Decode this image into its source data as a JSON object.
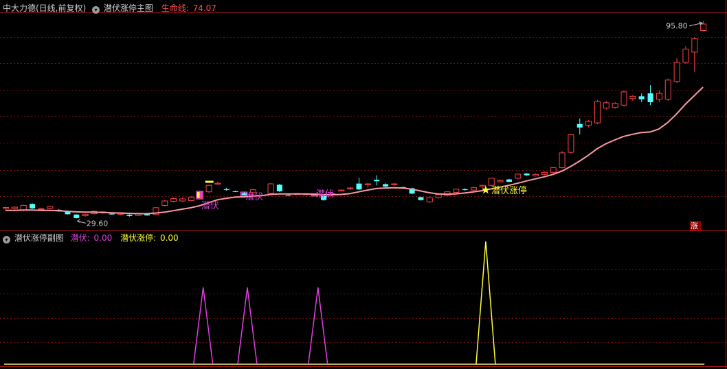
{
  "main_header": {
    "title": "中大力德(日线,前复权)",
    "indicator": "潜伏涨停主图",
    "line_label": "生命线:",
    "line_value": "74.07"
  },
  "sub_header": {
    "title": "潜伏涨停副图",
    "s1_label": "潜伏:",
    "s1_value": "0.00",
    "s2_label": "潜伏涨停:",
    "s2_value": "0.00"
  },
  "colors": {
    "up": "#ff4444",
    "down": "#54ffff",
    "ma": "#ff9aa6",
    "grid": "#7a1010",
    "qianfu": "#e040e0",
    "zhangting": "#ffff33"
  },
  "chart_data": [
    {
      "type": "candlestick",
      "name": "潜伏涨停主图",
      "price_range": [
        25.5,
        99.0
      ],
      "annotations": {
        "high": "95.80",
        "low": "29.60",
        "signal_label": "潜伏涨停",
        "qianfu_labels": [
          "潜伏",
          "潜伏",
          "潜伏"
        ],
        "zhang_badge": "涨"
      },
      "candles": [
        [
          33.0,
          33.3,
          32.8,
          32.6,
          33.6
        ],
        [
          32.9,
          33.4,
          32.7,
          32.6,
          33.6
        ],
        [
          32.4,
          34.0,
          32.2,
          32.0,
          34.2
        ],
        [
          34.5,
          33.0,
          33.1,
          32.8,
          34.7
        ],
        [
          32.8,
          32.9,
          32.7,
          32.5,
          33.2
        ],
        [
          33.0,
          33.6,
          32.8,
          32.7,
          33.8
        ],
        [
          32.5,
          32.0,
          32.5,
          31.9,
          32.7
        ],
        [
          32.0,
          31.0,
          31.9,
          30.9,
          32.2
        ],
        [
          30.9,
          29.7,
          30.9,
          29.6,
          31.0
        ],
        [
          30.5,
          31.0,
          30.4,
          30.2,
          31.2
        ],
        [
          31.2,
          32.0,
          31.1,
          30.9,
          32.2
        ],
        [
          31.5,
          31.8,
          31.3,
          31.2,
          32.0
        ],
        [
          31.2,
          31.0,
          31.1,
          30.9,
          31.4
        ],
        [
          31.0,
          31.5,
          30.8,
          30.7,
          31.6
        ],
        [
          30.8,
          30.4,
          30.7,
          30.2,
          31.0
        ],
        [
          30.6,
          31.2,
          30.5,
          30.4,
          31.4
        ],
        [
          31.0,
          30.6,
          30.9,
          30.5,
          31.1
        ],
        [
          30.9,
          33.2,
          30.8,
          30.7,
          33.4
        ],
        [
          34.0,
          35.5,
          33.8,
          33.6,
          35.8
        ],
        [
          35.4,
          36.3,
          35.2,
          35.1,
          36.6
        ],
        [
          35.5,
          36.2,
          35.4,
          35.2,
          36.5
        ],
        [
          35.6,
          36.8,
          35.5,
          35.4,
          37.2
        ],
        [
          36.5,
          38.5,
          36.3,
          36.2,
          38.8
        ],
        [
          38.6,
          40.8,
          38.5,
          38.3,
          41.0
        ],
        [
          41.4,
          41.5,
          41.2,
          41.0,
          42.0
        ],
        [
          39.5,
          39.3,
          39.4,
          39.0,
          40.0
        ],
        [
          38.8,
          38.6,
          38.7,
          38.5,
          39.0
        ],
        [
          38.2,
          37.5,
          38.1,
          37.4,
          38.5
        ],
        [
          38.3,
          39.3,
          38.3,
          38.0,
          39.6
        ],
        [
          37.5,
          37.4,
          37.5,
          37.2,
          37.8
        ],
        [
          38.1,
          41.3,
          38.0,
          37.8,
          41.6
        ],
        [
          41.0,
          38.8,
          41.0,
          38.5,
          41.3
        ],
        [
          37.6,
          37.5,
          37.6,
          37.4,
          37.8
        ],
        [
          37.9,
          38.0,
          37.8,
          37.7,
          38.2
        ],
        [
          37.8,
          37.9,
          37.7,
          37.6,
          38.0
        ],
        [
          37.5,
          37.6,
          37.4,
          37.3,
          37.8
        ],
        [
          37.2,
          35.8,
          37.1,
          35.6,
          37.3
        ],
        [
          38.0,
          37.8,
          37.8,
          37.6,
          38.0
        ],
        [
          39.1,
          39.2,
          39.0,
          38.9,
          39.3
        ],
        [
          39.8,
          39.9,
          39.6,
          39.2,
          40.2
        ],
        [
          41.4,
          39.4,
          41.3,
          39.2,
          43.4
        ],
        [
          41.2,
          41.3,
          41.0,
          40.0,
          41.6
        ],
        [
          42.7,
          42.2,
          42.5,
          40.8,
          44.2
        ],
        [
          41.2,
          40.4,
          41.0,
          40.2,
          41.5
        ],
        [
          41.0,
          41.3,
          40.8,
          40.6,
          41.6
        ],
        [
          40.2,
          39.8,
          40.1,
          39.6,
          40.4
        ],
        [
          39.8,
          38.0,
          39.8,
          37.8,
          40.0
        ],
        [
          36.8,
          35.8,
          36.8,
          35.6,
          37.0
        ],
        [
          35.2,
          36.6,
          35.0,
          34.8,
          36.8
        ],
        [
          36.6,
          37.7,
          36.4,
          36.3,
          37.9
        ],
        [
          37.4,
          38.6,
          37.3,
          37.2,
          38.8
        ],
        [
          38.4,
          39.5,
          38.3,
          38.2,
          39.7
        ],
        [
          39.5,
          39.2,
          39.3,
          39.0,
          39.8
        ],
        [
          39.2,
          40.0,
          39.1,
          39.0,
          40.3
        ],
        [
          40.3,
          40.8,
          40.2,
          40.0,
          41.0
        ],
        [
          40.8,
          43.2,
          40.7,
          40.5,
          43.4
        ],
        [
          42.0,
          42.4,
          42.0,
          41.8,
          42.8
        ],
        [
          42.8,
          42.0,
          42.7,
          41.9,
          43.0
        ],
        [
          43.2,
          44.6,
          43.0,
          42.8,
          44.8
        ],
        [
          44.8,
          44.2,
          44.6,
          44.0,
          45.0
        ],
        [
          44.0,
          44.5,
          43.9,
          43.8,
          44.8
        ],
        [
          44.5,
          45.2,
          44.4,
          44.2,
          45.5
        ],
        [
          45.2,
          46.8,
          45.0,
          44.9,
          47.0
        ],
        [
          46.8,
          51.8,
          46.6,
          46.5,
          52.4
        ],
        [
          52.0,
          58.0,
          51.8,
          51.6,
          58.2
        ],
        [
          61.6,
          60.4,
          61.6,
          58.0,
          63.5
        ],
        [
          61.2,
          62.5,
          61.0,
          60.5,
          63.0
        ],
        [
          62.0,
          69.2,
          61.8,
          61.5,
          69.8
        ],
        [
          67.0,
          68.8,
          67.0,
          66.5,
          69.5
        ],
        [
          67.2,
          68.6,
          67.0,
          66.8,
          69.0
        ],
        [
          68.0,
          72.5,
          67.8,
          67.5,
          73.0
        ],
        [
          70.2,
          71.0,
          70.0,
          69.5,
          71.4
        ],
        [
          71.0,
          70.0,
          70.8,
          69.0,
          72.0
        ],
        [
          72.0,
          69.0,
          72.0,
          68.0,
          74.8
        ],
        [
          70.0,
          72.0,
          69.5,
          69.0,
          73.0
        ],
        [
          70.0,
          76.5,
          69.8,
          69.5,
          77.0
        ],
        [
          76.0,
          82.5,
          75.8,
          75.5,
          84.0
        ],
        [
          82.5,
          87.0,
          82.3,
          82.0,
          88.0
        ],
        [
          86.0,
          90.5,
          85.8,
          79.3,
          91.0
        ],
        [
          93.3,
          95.5,
          93.2,
          93.0,
          96.5
        ]
      ],
      "ma_line": [
        32.3,
        32.3,
        32.4,
        32.4,
        32.3,
        32.3,
        32.2,
        32.0,
        31.8,
        31.7,
        31.7,
        31.6,
        31.5,
        31.4,
        31.3,
        31.2,
        31.2,
        31.4,
        31.7,
        32.2,
        32.7,
        33.2,
        33.9,
        34.9,
        35.9,
        36.4,
        36.8,
        36.9,
        37.2,
        37.3,
        37.7,
        37.9,
        37.9,
        37.9,
        37.9,
        37.8,
        37.6,
        37.6,
        37.7,
        38.0,
        38.6,
        39.2,
        39.7,
        39.9,
        40.0,
        39.9,
        39.5,
        38.9,
        38.3,
        37.9,
        37.8,
        37.9,
        38.2,
        38.6,
        39.0,
        39.6,
        40.2,
        40.8,
        41.5,
        42.3,
        43.0,
        43.7,
        44.5,
        45.6,
        47.2,
        49.0,
        51.0,
        53.2,
        54.9,
        56.2,
        57.4,
        58.1,
        58.7,
        58.9,
        59.9,
        62.1,
        65.0,
        68.3,
        71.2,
        74.1
      ],
      "qianfu_signal_bars": [
        22,
        27,
        35
      ],
      "zhangting_signal_bar": 54,
      "qianfu_boxes": [
        22,
        27,
        35
      ]
    },
    {
      "type": "line",
      "name": "潜伏涨停副图",
      "series": [
        {
          "name": "潜伏",
          "peaks_at_bar": [
            22,
            27,
            35
          ],
          "peak_value": 1,
          "baseline": 0
        },
        {
          "name": "潜伏涨停",
          "peaks_at_bar": [
            54
          ],
          "peak_value": 1.6,
          "baseline": 0
        }
      ]
    }
  ]
}
